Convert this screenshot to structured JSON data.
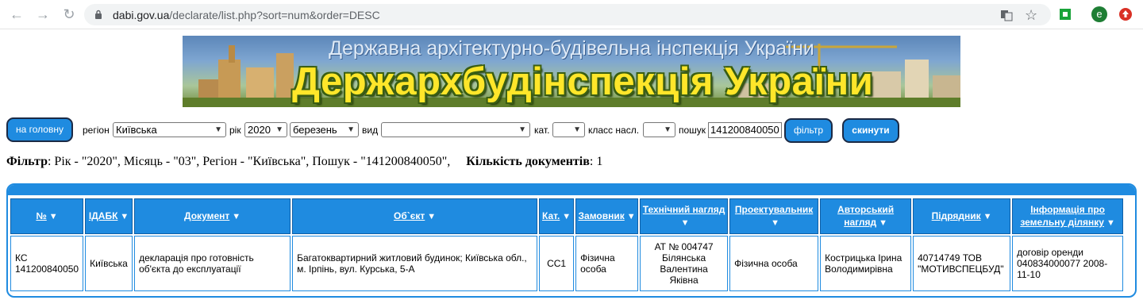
{
  "browser": {
    "url_host": "dabi.gov.ua",
    "url_path": "/declarate/list.php?sort=num&order=DESC",
    "profile_letter": "e"
  },
  "banner": {
    "subtitle": "Державна архітектурно-будівельна інспекція України",
    "title": "Держархбудінспекція України"
  },
  "filters": {
    "home_button": "на головну",
    "region_label": "регіон",
    "region_value": "Київська",
    "year_label": "рік",
    "year_value": "2020",
    "month_value": "березень",
    "type_label": "вид",
    "type_value": "",
    "cat_label": "кат.",
    "cat_value": "",
    "class_label": "класс насл.",
    "class_value": "",
    "search_label": "пошук",
    "search_value": "141200840050",
    "filter_button": "фільтр",
    "reset_button": "скинути"
  },
  "summary": {
    "filter_label": "Фільтр",
    "filter_text": ": Рік - \"2020\", Місяць - \"03\", Регіон - \"Київська\", Пошук - \"141200840050\",",
    "count_label": "Кількість документів",
    "count_value": ": 1"
  },
  "table": {
    "columns": [
      "№",
      "ІДАБК",
      "Документ",
      "Об`єкт",
      "Кат.",
      "Замовник",
      "Технічний нагляд",
      "Проектувальник",
      "Авторський нагляд",
      "Підрядник",
      "Інформація про земельну ділянку"
    ],
    "rows": [
      {
        "num": "КС 141200840050",
        "idabk": "Київська",
        "document": "декларація про готовність об'єкта до експлуатації",
        "object": "Багатоквартирний житловий будинок; Київська обл., м. Ірпінь, вул. Курська, 5-А",
        "category": "СС1",
        "customer": "Фізична особа",
        "tech_supervision": "АТ № 004747 Білянська Валентина Яківна",
        "designer": "Фізична особа",
        "author_supervision": "Кострицька Ірина Володимирівна",
        "contractor": "40714749 ТОВ \"МОТИВСПЕЦБУД\"",
        "land_info": "договір оренди 040834000077 2008-11-10"
      }
    ]
  },
  "colors": {
    "accent": "#1f8be0",
    "banner_title": "#ffe62a"
  }
}
